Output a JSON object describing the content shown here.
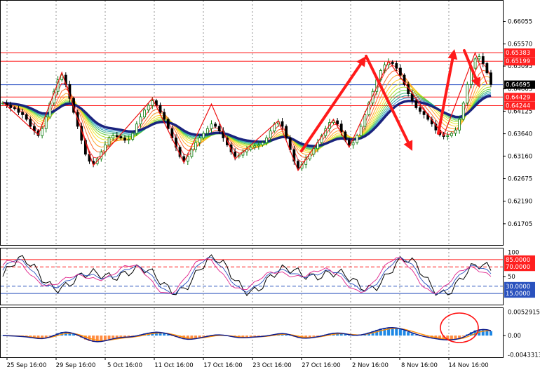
{
  "chart_data": [
    {
      "type": "line",
      "panel": "price",
      "title": "",
      "xlabel": "",
      "ylabel": "",
      "ylim": [
        0.6125,
        0.665
      ],
      "grid": true,
      "y_ticks": [
        "0.66055",
        "0.65570",
        "0.65095",
        "0.64605",
        "0.64125",
        "0.63640",
        "0.63160",
        "0.62675",
        "0.62190",
        "0.61705"
      ],
      "x_ticks": [
        "25 Sep 16:00",
        "29 Sep 16:00",
        "5 Oct 16:00",
        "11 Oct 16:00",
        "17 Oct 16:00",
        "23 Oct 16:00",
        "27 Oct 16:00",
        "2 Nov 16:00",
        "8 Nov 16:00",
        "14 Nov 16:00"
      ],
      "price_tags": [
        {
          "label": "0.65383",
          "value": 0.65383,
          "color": "#ff1f1f",
          "line": true
        },
        {
          "label": "0.65199",
          "value": 0.65199,
          "color": "#ff1f1f",
          "line": true
        },
        {
          "label": "0.64695",
          "value": 0.64695,
          "color": "#000000",
          "line": true,
          "line_color": "#3a5cc8"
        },
        {
          "label": "0.64429",
          "value": 0.64429,
          "color": "#ff1f1f",
          "line": true
        },
        {
          "label": "0.64244",
          "value": 0.64244,
          "color": "#ff1f1f",
          "line": true
        }
      ],
      "close_series": [
        0.643,
        0.6425,
        0.642,
        0.6418,
        0.641,
        0.6405,
        0.6395,
        0.638,
        0.637,
        0.636,
        0.6375,
        0.64,
        0.643,
        0.6455,
        0.648,
        0.649,
        0.647,
        0.644,
        0.641,
        0.638,
        0.635,
        0.632,
        0.6305,
        0.63,
        0.631,
        0.6325,
        0.634,
        0.6355,
        0.636,
        0.6358,
        0.6355,
        0.635,
        0.6352,
        0.6365,
        0.6385,
        0.64,
        0.6415,
        0.6425,
        0.6435,
        0.6425,
        0.641,
        0.6395,
        0.6375,
        0.6355,
        0.6335,
        0.6315,
        0.6305,
        0.6315,
        0.633,
        0.6345,
        0.6355,
        0.6365,
        0.6375,
        0.6385,
        0.638,
        0.637,
        0.6355,
        0.634,
        0.6325,
        0.6315,
        0.6318,
        0.6325,
        0.633,
        0.6335,
        0.6338,
        0.634,
        0.6345,
        0.6355,
        0.637,
        0.6385,
        0.639,
        0.638,
        0.6355,
        0.633,
        0.6305,
        0.629,
        0.6298,
        0.631,
        0.632,
        0.6332,
        0.6345,
        0.636,
        0.6375,
        0.6388,
        0.6392,
        0.6385,
        0.6368,
        0.635,
        0.634,
        0.6345,
        0.636,
        0.638,
        0.6405,
        0.643,
        0.6455,
        0.648,
        0.65,
        0.6512,
        0.6518,
        0.6515,
        0.6505,
        0.649,
        0.647,
        0.645,
        0.6435,
        0.642,
        0.6412,
        0.6405,
        0.6395,
        0.6385,
        0.6372,
        0.6362,
        0.6358,
        0.636,
        0.6365,
        0.6372,
        0.6395,
        0.643,
        0.647,
        0.6505,
        0.6525,
        0.653,
        0.6515,
        0.6495,
        0.647
      ],
      "ma_series": [
        {
          "name": "",
          "color": "#1a237e"
        },
        {
          "name": "",
          "color": "#ff3b00"
        },
        {
          "name": "",
          "color": "#ff9800"
        },
        {
          "name": "",
          "color": "#cddc39"
        },
        {
          "name": "",
          "color": "#4caf50"
        },
        {
          "name": "",
          "color": "#009688"
        }
      ],
      "zigzag_color": "#ee1111",
      "annotation_color": "#ff1a1a"
    },
    {
      "type": "line",
      "panel": "oscillator",
      "ylim": [
        -8,
        108
      ],
      "y_ticks": [
        "100",
        "85.0000",
        "70.0000",
        "50",
        "30.0000",
        "15.0000"
      ],
      "levels": [
        {
          "label": "85.0000",
          "value": 85,
          "color": "#ff1f1f",
          "style": "solid"
        },
        {
          "label": "70.0000",
          "value": 70,
          "color": "#ff1f1f",
          "style": "dash"
        },
        {
          "label": "30.0000",
          "value": 30,
          "color": "#2a52be",
          "style": "dash"
        },
        {
          "label": "15.0000",
          "value": 15,
          "color": "#2a52be",
          "style": "solid"
        }
      ],
      "series": [
        {
          "name": "",
          "color": "#000000"
        },
        {
          "name": "",
          "color": "#2a52be"
        },
        {
          "name": "",
          "color": "#e0218a"
        }
      ]
    },
    {
      "type": "bar",
      "panel": "macd",
      "ylim": [
        -0.0049,
        0.0062
      ],
      "y_ticks": [
        "0.0052915",
        "0.00",
        "-0.0043313"
      ],
      "positive_color": "#1e88e5",
      "negative_color": "#ff8c42",
      "signal_color": "#ff8c00",
      "macd_color": "#0d1b8c",
      "highlight_color": "#ff1111"
    }
  ]
}
